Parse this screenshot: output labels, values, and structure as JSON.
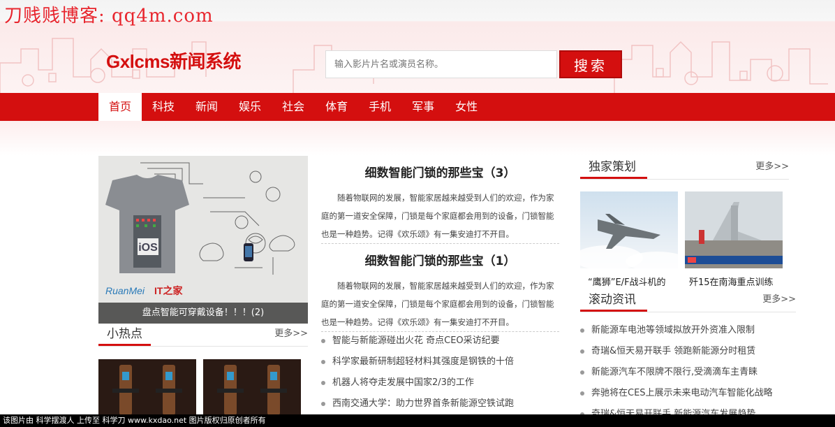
{
  "watermark": "刀贱贱博客: qq4m.com",
  "logo": "Gxlcms新闻系统",
  "search": {
    "placeholder": "输入影片片名或演员名称。",
    "button": "搜索"
  },
  "nav": [
    {
      "label": "首页",
      "active": true
    },
    {
      "label": "科技"
    },
    {
      "label": "新闻"
    },
    {
      "label": "娱乐"
    },
    {
      "label": "社会"
    },
    {
      "label": "体育"
    },
    {
      "label": "手机"
    },
    {
      "label": "军事"
    },
    {
      "label": "女性"
    }
  ],
  "slide": {
    "caption": "盘点智能可穿戴设备！！！(2)",
    "shirt_text": "iOS",
    "brand": "RuanMei",
    "brand2": "IT之家"
  },
  "hot": {
    "title": "小热点",
    "more": "更多>>"
  },
  "articles": [
    {
      "title": "细数智能门锁的那些宝（3）",
      "body": "随着物联网的发展，智能家居越来越受到人们的欢迎，作为家庭的第一道安全保障，门锁是每个家庭都会用到的设备，门锁智能也是一种趋势。记得《欢乐颂》有一集安迪打不开目。"
    },
    {
      "title": "细数智能门锁的那些宝（1）",
      "body": "随着物联网的发展，智能家居越来越受到人们的欢迎，作为家庭的第一道安全保障，门锁是每个家庭都会用到的设备，门锁智能也是一种趋势。记得《欢乐颂》有一集安迪打不开目。"
    }
  ],
  "mid_list": [
    "智能与新能源碰出火花 奇点CEO采访纪要",
    "科学家最新研制超轻材料其强度是钢铁的十倍",
    "机器人将夺走发展中国家2/3的工作",
    "西南交通大学：助力世界首条新能源空铁试跑"
  ],
  "exclusive": {
    "title": "独家策划",
    "more": "更多>>",
    "items": [
      {
        "caption": "“鹰狮”E/F战斗机的"
      },
      {
        "caption": "歼15在南海重点训练"
      }
    ]
  },
  "scroll": {
    "title": "滚动资讯",
    "more": "更多>>",
    "items": [
      "新能源车电池等领域拟放开外资准入限制",
      "奇瑞&恒天易开联手 领跑新能源分时租赁",
      "新能源汽车不限牌不限行,受滴滴车主青睐",
      "奔驰将在CES上展示未来电动汽车智能化战略",
      "奇瑞&恒天易开联手 新能源汽车发展趋势"
    ]
  },
  "footer": "该图片由 科学摆渡人 上传至 科学刀 www.kxdao.net 图片版权归原创者所有"
}
